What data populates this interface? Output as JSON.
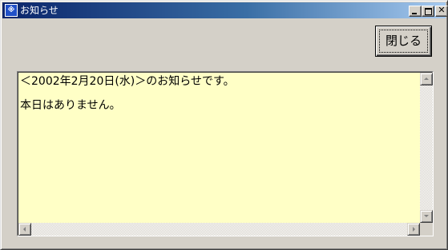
{
  "window": {
    "title": "お知らせ",
    "app_icon": "notice-app-icon",
    "app_icon_glyph": "※",
    "controls": [
      "minimize",
      "maximize",
      "close"
    ]
  },
  "toolbar": {
    "close_label": "閉じる"
  },
  "message": {
    "lines": [
      "＜2002年2月20日(水)＞のお知らせです。",
      "本日はありません。"
    ]
  },
  "scrollbars": {
    "vertical": {
      "up_icon": "arrow-up-icon",
      "down_icon": "arrow-down-icon"
    },
    "horizontal": {
      "left_icon": "arrow-left-icon",
      "right_icon": "arrow-right-icon"
    }
  },
  "colors": {
    "title_gradient_start": "#0a246a",
    "title_gradient_end": "#a6caf0",
    "textarea_background": "#ffffc6",
    "face": "#d4d0c8"
  }
}
